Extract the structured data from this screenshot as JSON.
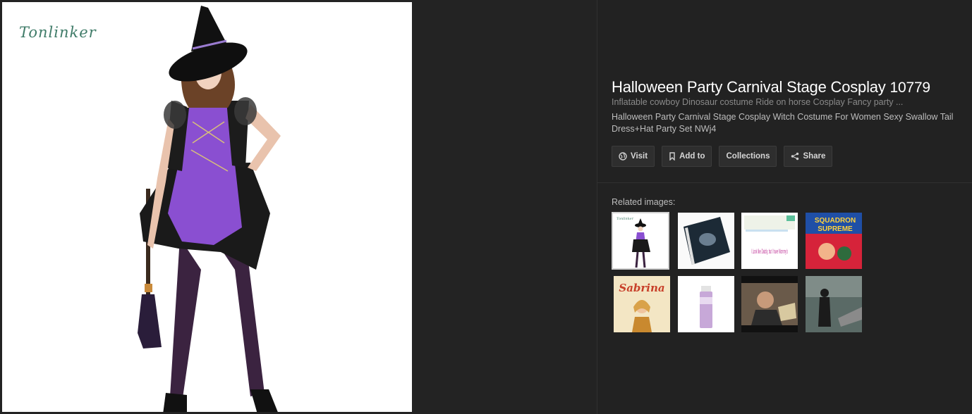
{
  "preview": {
    "watermark": "Tonlinker"
  },
  "details": {
    "title": "Halloween Party Carnival Stage Cosplay",
    "title_number": "10779",
    "subtitle": "Inflatable cowboy Dinosaur costume Ride on horse Cosplay Fancy party ...",
    "description": "Halloween Party Carnival Stage Cosplay Witch Costume For Women Sexy Swallow Tail Dress+Hat Party Set NWj4"
  },
  "actions": {
    "visit": "Visit",
    "add_to": "Add to",
    "collections": "Collections",
    "share": "Share"
  },
  "related": {
    "label": "Related images:",
    "thumb1_mini_watermark": "Tonlinker",
    "thumb3_text": "I Look like Daddy, but I have Mommy's",
    "thumb4_line1": "SQUADRON",
    "thumb4_line2": "SUPREME",
    "thumb5_text": "Sabrina"
  },
  "colors": {
    "background": "#222222",
    "button_bg": "#2e2e2e",
    "dress_purple": "#8a4fd1"
  }
}
